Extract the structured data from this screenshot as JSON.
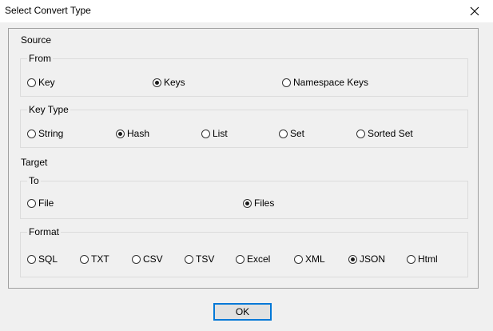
{
  "window": {
    "title": "Select Convert Type"
  },
  "source": {
    "label": "Source",
    "from": {
      "label": "From",
      "options": [
        {
          "label": "Key",
          "checked": false
        },
        {
          "label": "Keys",
          "checked": true
        },
        {
          "label": "Namespace Keys",
          "checked": false
        }
      ]
    },
    "key_type": {
      "label": "Key Type",
      "options": [
        {
          "label": "String",
          "checked": false
        },
        {
          "label": "Hash",
          "checked": true
        },
        {
          "label": "List",
          "checked": false
        },
        {
          "label": "Set",
          "checked": false
        },
        {
          "label": "Sorted Set",
          "checked": false
        }
      ]
    }
  },
  "target": {
    "label": "Target",
    "to": {
      "label": "To",
      "options": [
        {
          "label": "File",
          "checked": false
        },
        {
          "label": "Files",
          "checked": true
        }
      ]
    },
    "format": {
      "label": "Format",
      "options": [
        {
          "label": "SQL",
          "checked": false
        },
        {
          "label": "TXT",
          "checked": false
        },
        {
          "label": "CSV",
          "checked": false
        },
        {
          "label": "TSV",
          "checked": false
        },
        {
          "label": "Excel",
          "checked": false
        },
        {
          "label": "XML",
          "checked": false
        },
        {
          "label": "JSON",
          "checked": true
        },
        {
          "label": "Html",
          "checked": false
        }
      ]
    }
  },
  "buttons": {
    "ok_label": "OK"
  }
}
